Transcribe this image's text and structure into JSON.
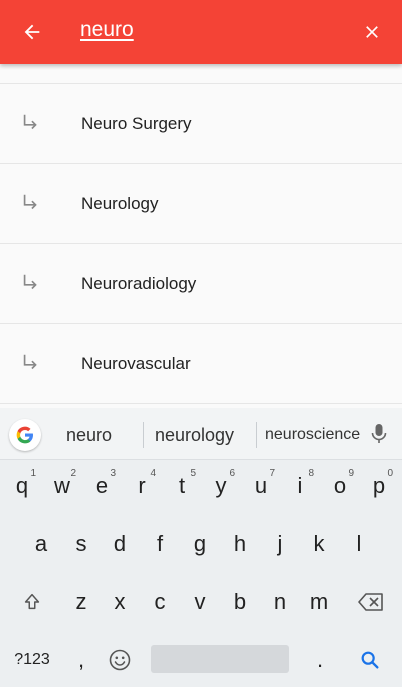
{
  "search": {
    "query": "neuro"
  },
  "suggestions": [
    {
      "label": "Neuro Surgery"
    },
    {
      "label": "Neurology"
    },
    {
      "label": "Neuroradiology"
    },
    {
      "label": "Neurovascular"
    }
  ],
  "keyboard": {
    "suggestion_strip": [
      "neuro",
      "neurology",
      "neuroscience"
    ],
    "row1": [
      {
        "k": "q",
        "n": "1"
      },
      {
        "k": "w",
        "n": "2"
      },
      {
        "k": "e",
        "n": "3"
      },
      {
        "k": "r",
        "n": "4"
      },
      {
        "k": "t",
        "n": "5"
      },
      {
        "k": "y",
        "n": "6"
      },
      {
        "k": "u",
        "n": "7"
      },
      {
        "k": "i",
        "n": "8"
      },
      {
        "k": "o",
        "n": "9"
      },
      {
        "k": "p",
        "n": "0"
      }
    ],
    "row2": [
      "a",
      "s",
      "d",
      "f",
      "g",
      "h",
      "j",
      "k",
      "l"
    ],
    "row3": [
      "z",
      "x",
      "c",
      "v",
      "b",
      "n",
      "m"
    ],
    "symbols_label": "?123",
    "comma": ",",
    "period": "."
  },
  "colors": {
    "appbar": "#f44336",
    "action_blue": "#1a73e8"
  },
  "icons": {
    "back": "arrow-left-icon",
    "clear": "close-icon",
    "suggestion": "subdirectory-arrow-right-icon",
    "google": "google-g-icon",
    "mic": "microphone-icon",
    "shift": "shift-arrow-icon",
    "backspace": "backspace-icon",
    "emoji": "emoji-icon",
    "search": "search-icon"
  }
}
